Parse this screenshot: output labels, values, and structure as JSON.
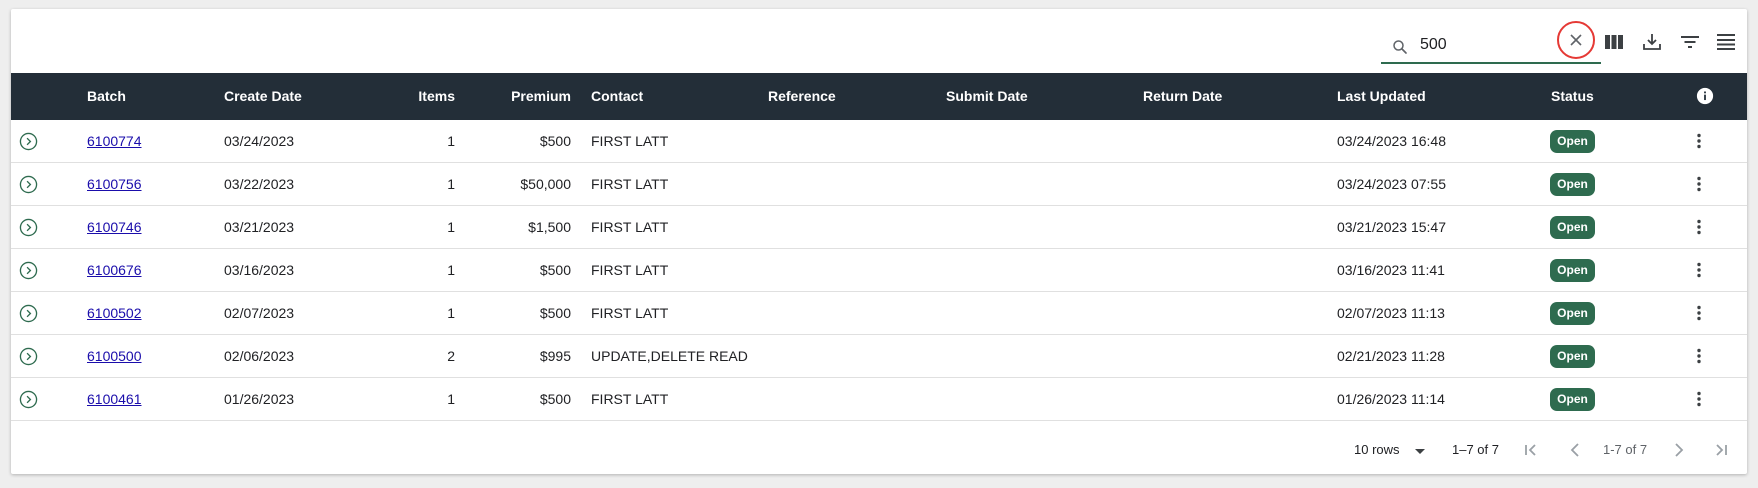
{
  "search": {
    "value": "500",
    "placeholder": ""
  },
  "toolbar": {
    "clear_icon": "close-icon",
    "columns_icon": "view-columns-icon",
    "download_icon": "download-icon",
    "filter_icon": "filter-icon",
    "density_icon": "density-icon"
  },
  "table": {
    "columns": [
      "Batch",
      "Create Date",
      "Items",
      "Premium",
      "Contact",
      "Reference",
      "Submit Date",
      "Return Date",
      "Last Updated",
      "Status"
    ],
    "rows": [
      {
        "batch": "6100774",
        "create_date": "03/24/2023",
        "items": "1",
        "premium": "$500",
        "contact": "FIRST LATT",
        "reference": "",
        "submit_date": "",
        "return_date": "",
        "last_updated": "03/24/2023 16:48",
        "status": "Open"
      },
      {
        "batch": "6100756",
        "create_date": "03/22/2023",
        "items": "1",
        "premium": "$50,000",
        "contact": "FIRST LATT",
        "reference": "",
        "submit_date": "",
        "return_date": "",
        "last_updated": "03/24/2023 07:55",
        "status": "Open"
      },
      {
        "batch": "6100746",
        "create_date": "03/21/2023",
        "items": "1",
        "premium": "$1,500",
        "contact": "FIRST LATT",
        "reference": "",
        "submit_date": "",
        "return_date": "",
        "last_updated": "03/21/2023 15:47",
        "status": "Open"
      },
      {
        "batch": "6100676",
        "create_date": "03/16/2023",
        "items": "1",
        "premium": "$500",
        "contact": "FIRST LATT",
        "reference": "",
        "submit_date": "",
        "return_date": "",
        "last_updated": "03/16/2023 11:41",
        "status": "Open"
      },
      {
        "batch": "6100502",
        "create_date": "02/07/2023",
        "items": "1",
        "premium": "$500",
        "contact": "FIRST LATT",
        "reference": "",
        "submit_date": "",
        "return_date": "",
        "last_updated": "02/07/2023 11:13",
        "status": "Open"
      },
      {
        "batch": "6100500",
        "create_date": "02/06/2023",
        "items": "2",
        "premium": "$995",
        "contact": "UPDATE,DELETE READ",
        "reference": "",
        "submit_date": "",
        "return_date": "",
        "last_updated": "02/21/2023 11:28",
        "status": "Open"
      },
      {
        "batch": "6100461",
        "create_date": "01/26/2023",
        "items": "1",
        "premium": "$500",
        "contact": "FIRST LATT",
        "reference": "",
        "submit_date": "",
        "return_date": "",
        "last_updated": "01/26/2023 11:14",
        "status": "Open"
      }
    ]
  },
  "footer": {
    "rows_per_page": "10 rows",
    "range": "1–7 of 7",
    "range_secondary": "1-7 of 7"
  },
  "colors": {
    "header_bg": "#232e38",
    "status_badge": "#2e6b4f",
    "link": "#1a0dab",
    "highlight_ring": "#e53935"
  }
}
